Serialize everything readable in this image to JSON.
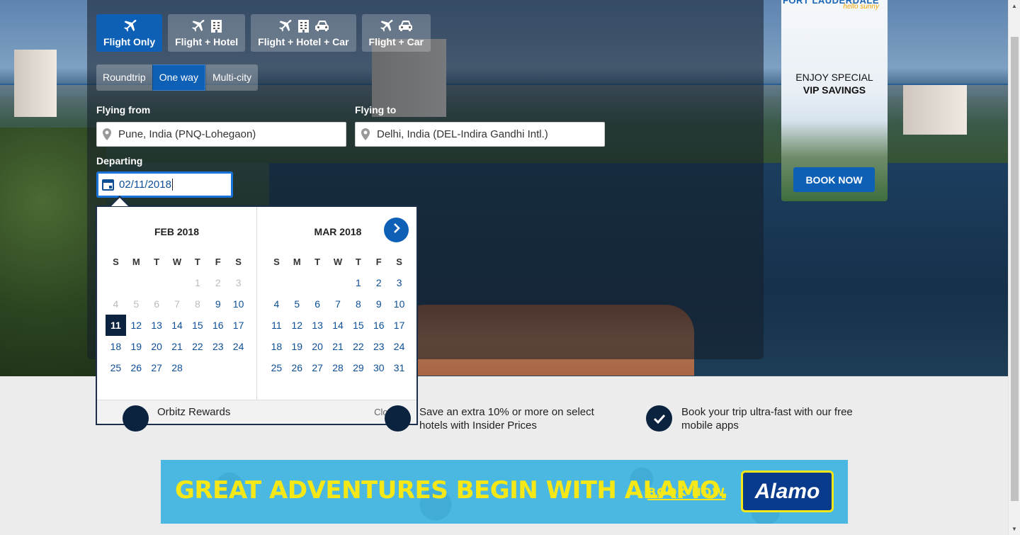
{
  "product_tabs": [
    {
      "label": "Flight Only",
      "icons": [
        "plane-icon"
      ],
      "active": true
    },
    {
      "label": "Flight + Hotel",
      "icons": [
        "plane-icon",
        "hotel-icon"
      ],
      "active": false
    },
    {
      "label": "Flight + Hotel + Car",
      "icons": [
        "plane-icon",
        "hotel-icon",
        "car-icon"
      ],
      "active": false
    },
    {
      "label": "Flight + Car",
      "icons": [
        "plane-icon",
        "car-icon"
      ],
      "active": false
    }
  ],
  "trip_types": [
    {
      "label": "Roundtrip",
      "active": false
    },
    {
      "label": "One way",
      "active": true
    },
    {
      "label": "Multi-city",
      "active": false
    }
  ],
  "form": {
    "from_label": "Flying from",
    "from_value": "Pune, India (PNQ-Lohegaon)",
    "to_label": "Flying to",
    "to_value": "Delhi, India (DEL-Indira Gandhi Intl.)",
    "depart_label": "Departing",
    "depart_value": "02/11/2018"
  },
  "calendar": {
    "weekdays": [
      "S",
      "M",
      "T",
      "W",
      "T",
      "F",
      "S"
    ],
    "months": [
      {
        "title": "FEB 2018",
        "weeks": [
          [
            {
              "d": ""
            },
            {
              "d": ""
            },
            {
              "d": ""
            },
            {
              "d": ""
            },
            {
              "d": "1",
              "dis": true
            },
            {
              "d": "2",
              "dis": true
            },
            {
              "d": "3",
              "dis": true
            }
          ],
          [
            {
              "d": "4",
              "dis": true
            },
            {
              "d": "5",
              "dis": true
            },
            {
              "d": "6",
              "dis": true
            },
            {
              "d": "7",
              "dis": true
            },
            {
              "d": "8",
              "dis": true
            },
            {
              "d": "9"
            },
            {
              "d": "10"
            }
          ],
          [
            {
              "d": "11",
              "sel": true
            },
            {
              "d": "12"
            },
            {
              "d": "13"
            },
            {
              "d": "14"
            },
            {
              "d": "15"
            },
            {
              "d": "16"
            },
            {
              "d": "17"
            }
          ],
          [
            {
              "d": "18"
            },
            {
              "d": "19"
            },
            {
              "d": "20"
            },
            {
              "d": "21"
            },
            {
              "d": "22"
            },
            {
              "d": "23"
            },
            {
              "d": "24"
            }
          ],
          [
            {
              "d": "25"
            },
            {
              "d": "26"
            },
            {
              "d": "27"
            },
            {
              "d": "28"
            },
            {
              "d": ""
            },
            {
              "d": ""
            },
            {
              "d": ""
            }
          ]
        ]
      },
      {
        "title": "MAR 2018",
        "weeks": [
          [
            {
              "d": ""
            },
            {
              "d": ""
            },
            {
              "d": ""
            },
            {
              "d": ""
            },
            {
              "d": "1"
            },
            {
              "d": "2"
            },
            {
              "d": "3"
            }
          ],
          [
            {
              "d": "4"
            },
            {
              "d": "5"
            },
            {
              "d": "6"
            },
            {
              "d": "7"
            },
            {
              "d": "8"
            },
            {
              "d": "9"
            },
            {
              "d": "10"
            }
          ],
          [
            {
              "d": "11"
            },
            {
              "d": "12"
            },
            {
              "d": "13"
            },
            {
              "d": "14"
            },
            {
              "d": "15"
            },
            {
              "d": "16"
            },
            {
              "d": "17"
            }
          ],
          [
            {
              "d": "18"
            },
            {
              "d": "19"
            },
            {
              "d": "20"
            },
            {
              "d": "21"
            },
            {
              "d": "22"
            },
            {
              "d": "23"
            },
            {
              "d": "24"
            }
          ],
          [
            {
              "d": "25"
            },
            {
              "d": "26"
            },
            {
              "d": "27"
            },
            {
              "d": "28"
            },
            {
              "d": "29"
            },
            {
              "d": "30"
            },
            {
              "d": "31"
            }
          ]
        ]
      }
    ],
    "close_label": "Close",
    "close_icon": "×"
  },
  "side_ad": {
    "brand": "FORT LAUDERDALE",
    "tagline": "hello sunny",
    "line1": "ENJOY SPECIAL",
    "line2": "VIP SAVINGS",
    "button": "BOOK NOW"
  },
  "features": [
    {
      "text_line1": "",
      "text_line2": "Orbitz Rewards"
    },
    {
      "text_line1": "Save an extra 10% or more on select",
      "text_line2": "hotels with Insider Prices"
    },
    {
      "text_line1": "Book your trip ultra-fast with our free",
      "text_line2": "mobile apps"
    }
  ],
  "banner": {
    "headline": "GREAT ADVENTURES BEGIN WITH ALAMO.",
    "cta": "BOOK NOW",
    "logo": "Alamo"
  },
  "colors": {
    "primary": "#0d60b5",
    "selected_day": "#0c2340",
    "banner_yellow": "#f6e817",
    "banner_blue": "#4ab8e0"
  }
}
